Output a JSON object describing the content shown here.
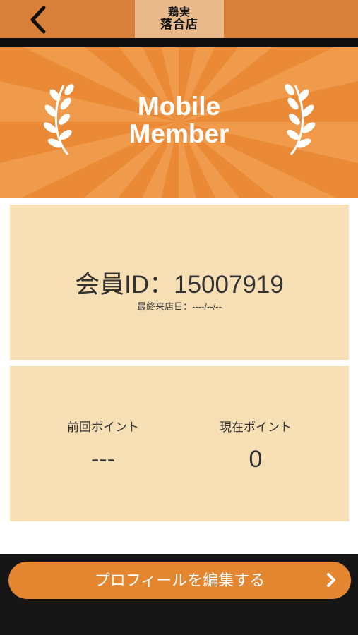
{
  "header": {
    "back_icon": "chevron-left-icon",
    "logo_line1": "鶏実",
    "logo_line2": "落合店"
  },
  "banner": {
    "title_line1": "Mobile",
    "title_line2": "Member",
    "icons": [
      "laurel-left-icon",
      "laurel-right-icon"
    ]
  },
  "member": {
    "id_text": "会員ID：15007919",
    "last_visit": "最終来店日：----/--/--"
  },
  "points": {
    "previous_label": "前回ポイント",
    "previous_value": "---",
    "current_label": "現在ポイント",
    "current_value": "0"
  },
  "actions": {
    "edit_profile_label": "プロフィールを編集する",
    "arrow_icon": "chevron-right-icon"
  },
  "colors": {
    "header": "#d9813a",
    "banner": "#ea8a36",
    "card": "#f7dfb5",
    "button": "#e48530",
    "bottom": "#161616"
  }
}
